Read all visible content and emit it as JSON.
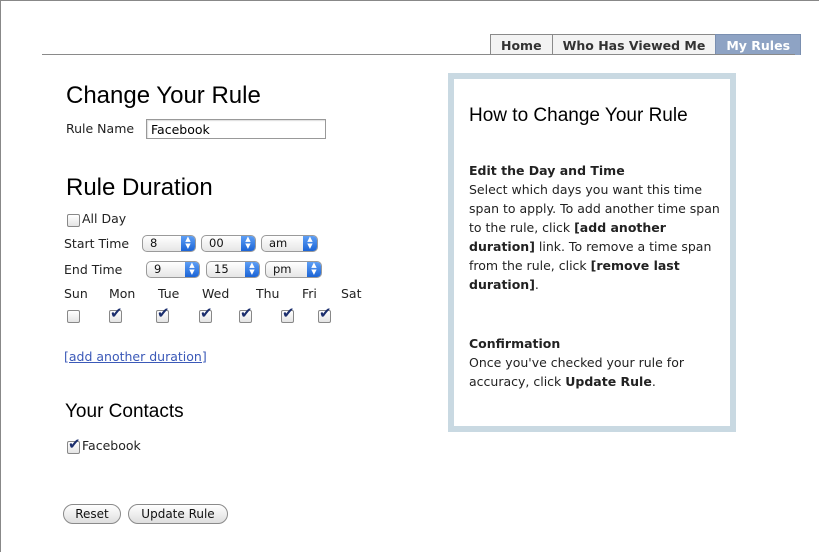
{
  "tabs": [
    {
      "label": "Home",
      "active": false
    },
    {
      "label": "Who Has Viewed Me",
      "active": false
    },
    {
      "label": "My Rules",
      "active": true
    }
  ],
  "form": {
    "title": "Change Your Rule",
    "rule_name_label": "Rule Name",
    "rule_name_value": "Facebook",
    "duration_title": "Rule Duration",
    "all_day_label": "All Day",
    "all_day_checked": false,
    "start_time_label": "Start Time",
    "start_hour": "8",
    "start_minute": "00",
    "start_ampm": "am",
    "end_time_label": "End Time",
    "end_hour": "9",
    "end_minute": "15",
    "end_ampm": "pm",
    "days": [
      {
        "label": "Sun",
        "checked": false
      },
      {
        "label": "Mon",
        "checked": true
      },
      {
        "label": "Tue",
        "checked": true
      },
      {
        "label": "Wed",
        "checked": true
      },
      {
        "label": "Thu",
        "checked": true
      },
      {
        "label": "Fri",
        "checked": true
      },
      {
        "label": "Sat",
        "checked": true
      }
    ],
    "add_duration_link": "[add another duration]",
    "contacts_title": "Your Contacts",
    "contacts": [
      {
        "label": "Facebook",
        "checked": true
      }
    ],
    "reset_button": "Reset",
    "update_button": "Update Rule"
  },
  "help": {
    "title": "How to Change Your Rule",
    "section1_title": "Edit the Day and Time",
    "section1_text_a": "Select which days you want this time span to apply. To add another time span to the rule, click ",
    "section1_bold_a": "[add another duration]",
    "section1_text_b": " link. To remove a time span from the rule, click ",
    "section1_bold_b": "[remove last duration]",
    "section1_text_c": ".",
    "section2_title": "Confirmation",
    "section2_text_a": "Once you've checked your rule for accuracy, click ",
    "section2_bold": "Update Rule",
    "section2_text_b": "."
  },
  "colors": {
    "active_tab": "#8ea3c4",
    "help_border": "#c9d9e2",
    "link": "#3b59b8",
    "select_arrow": "#1c64d6"
  }
}
